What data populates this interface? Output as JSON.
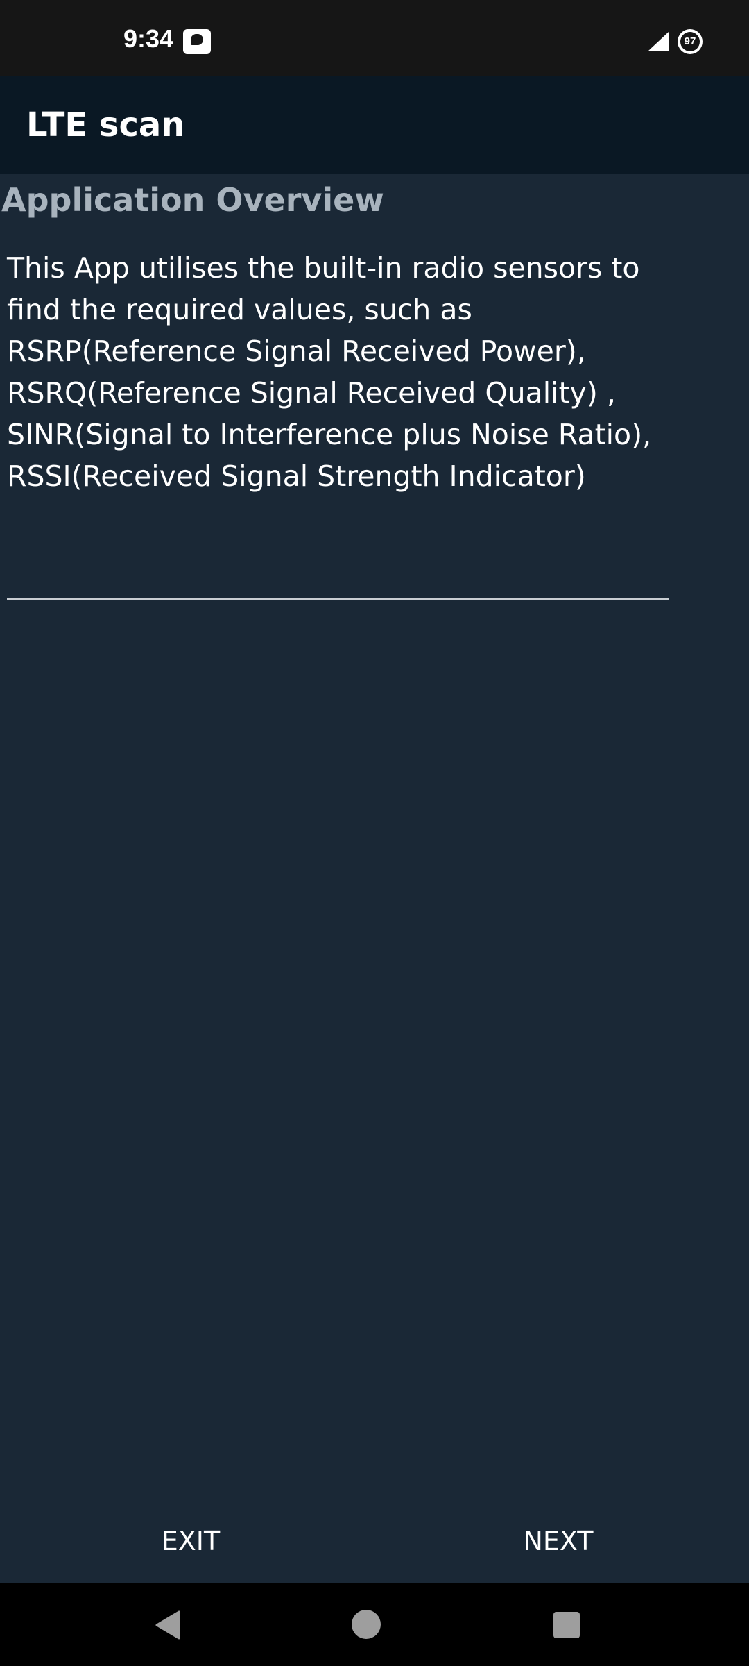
{
  "status_bar": {
    "time": "9:34",
    "battery_level": "97",
    "icons": [
      "notification-app-icon",
      "signal-icon",
      "battery-icon"
    ]
  },
  "app_bar": {
    "title": "LTE scan"
  },
  "overview": {
    "heading": "Application Overview",
    "body": "This App utilises the built-in radio sensors to find the required values, such as RSRP(Reference Signal Received Power), RSRQ(Reference Signal Received Quality) , SINR(Signal to Interference plus Noise Ratio), RSSI(Received Signal Strength Indicator)"
  },
  "actions": {
    "exit_label": "EXIT",
    "next_label": "NEXT"
  },
  "nav_bar": {
    "icons": [
      "back-icon",
      "home-icon",
      "recents-icon"
    ]
  },
  "colors": {
    "status_bar_bg": "#161616",
    "app_bar_bg": "#0a1824",
    "content_bg": "#1a2836",
    "heading_text": "#a8b3bd",
    "body_text": "#ffffff"
  }
}
